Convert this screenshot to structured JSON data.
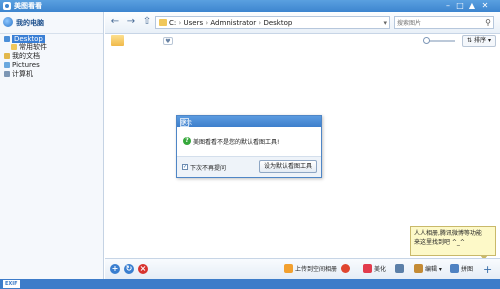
{
  "window": {
    "title": "美图看看",
    "controls": [
      "minimize-icon",
      "restore-icon",
      "shirt-icon",
      "close-icon"
    ]
  },
  "sidebar": {
    "header": "我的电脑",
    "items": [
      {
        "label": "Desktop",
        "icon": "desktop-icon",
        "selected": true
      },
      {
        "label": "常用软件",
        "icon": "folder-icon"
      },
      {
        "label": "我的文档",
        "icon": "documents-icon"
      },
      {
        "label": "Pictures",
        "icon": "pictures-icon"
      },
      {
        "label": "计算机",
        "icon": "computer-icon"
      }
    ]
  },
  "navbar": {
    "back_icon": "back-arrow-icon",
    "forward_icon": "forward-arrow-icon",
    "up_icon": "up-folder-icon",
    "path": [
      "C:",
      "Users",
      "Admnistrator",
      "Desktop"
    ],
    "search_placeholder": "搜索图片"
  },
  "toolbar": {
    "sort_label": "排序"
  },
  "dialog": {
    "title": "提示",
    "message": "美图看看不是您的默认看图工具!",
    "checkbox_label": "下次不再提问",
    "checkbox_checked": true,
    "set_default_label": "设为默认看图工具"
  },
  "tooltip": {
    "lines": [
      "人人相册,腾讯微博等功能",
      "来这里找到吧 ^_^"
    ]
  },
  "bottombar": {
    "upload_label": "上传到空间相册",
    "beautify_label": "美化",
    "edit_label": "编辑",
    "thumb_label": "拼图"
  },
  "statusbar": {
    "exif_label": "EXIF"
  },
  "colors": {
    "title_blue": "#3d85cf",
    "status_blue": "#3d7cc9",
    "tooltip_bg": "#fdf9c8"
  }
}
